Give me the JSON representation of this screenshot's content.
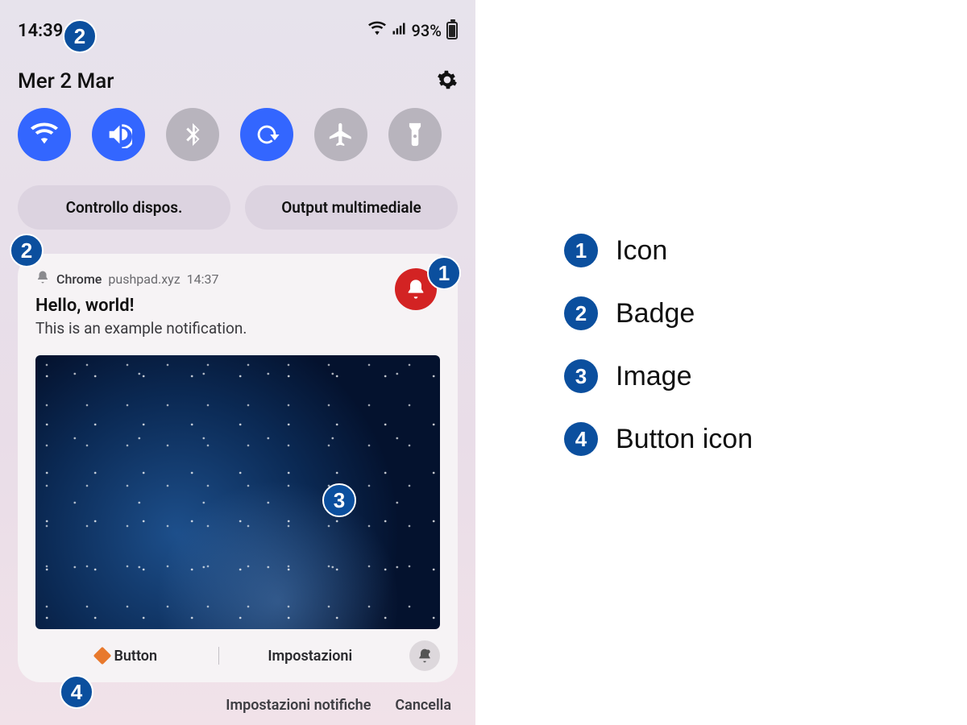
{
  "status": {
    "time": "14:39",
    "battery_text": "93%"
  },
  "date_row": {
    "date": "Mer 2 Mar"
  },
  "controls": {
    "device": "Controllo dispos.",
    "media": "Output multimediale"
  },
  "notification": {
    "app": "Chrome",
    "source": "pushpad.xyz",
    "time": "14:37",
    "title": "Hello, world!",
    "body": "This is an example notification.",
    "action_button": "Button",
    "action_settings": "Impostazioni"
  },
  "bottom": {
    "settings": "Impostazioni notifiche",
    "clear": "Cancella"
  },
  "legend": {
    "items": [
      {
        "n": "1",
        "label": "Icon"
      },
      {
        "n": "2",
        "label": "Badge"
      },
      {
        "n": "3",
        "label": "Image"
      },
      {
        "n": "4",
        "label": "Button icon"
      }
    ]
  },
  "callouts": {
    "c1": "1",
    "c2a": "2",
    "c2b": "2",
    "c3": "3",
    "c4": "4"
  }
}
